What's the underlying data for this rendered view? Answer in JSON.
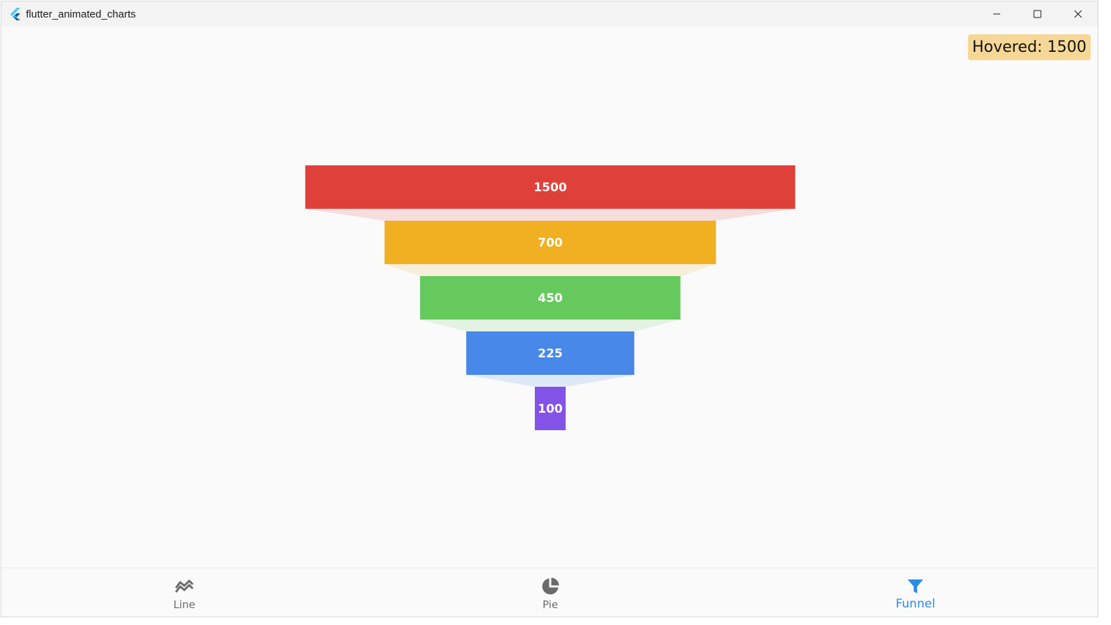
{
  "window": {
    "title": "flutter_animated_charts",
    "controls": [
      "minimize",
      "maximize",
      "close"
    ]
  },
  "hover_status": "Hovered: 1500",
  "chart_data": {
    "type": "funnel",
    "stages": [
      {
        "value": 1500,
        "label": "1500",
        "color": "#e0403a"
      },
      {
        "value": 700,
        "label": "700",
        "color": "#f0b022"
      },
      {
        "value": 450,
        "label": "450",
        "color": "#66c95e"
      },
      {
        "value": 225,
        "label": "225",
        "color": "#4788e8"
      },
      {
        "value": 100,
        "label": "100",
        "color": "#8352e6"
      }
    ],
    "hovered_stage": 0
  },
  "nav": {
    "items": [
      {
        "label": "Line",
        "icon": "line-chart-icon",
        "active": false
      },
      {
        "label": "Pie",
        "icon": "pie-chart-icon",
        "active": false
      },
      {
        "label": "Funnel",
        "icon": "funnel-icon",
        "active": true
      }
    ],
    "active_color": "#2b8be8",
    "inactive_color": "#6b6b6b"
  }
}
